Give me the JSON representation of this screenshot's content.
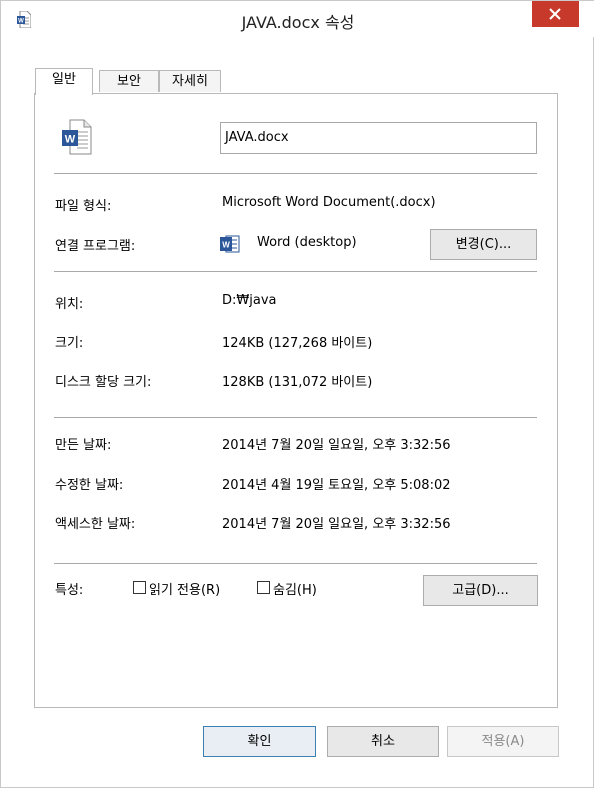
{
  "window": {
    "title": "JAVA.docx 속성"
  },
  "tabs": [
    {
      "label": "일반"
    },
    {
      "label": "보안"
    },
    {
      "label": "자세히"
    }
  ],
  "file": {
    "name": "JAVA.docx"
  },
  "general": {
    "file_type_label": "파일 형식:",
    "file_type_value": "Microsoft Word Document(.docx)",
    "opens_with_label": "연결 프로그램:",
    "opens_with_value": "Word (desktop)",
    "change_button": "변경(C)...",
    "location_label": "위치:",
    "location_value": "D:₩java",
    "size_label": "크기:",
    "size_value": "124KB (127,268 바이트)",
    "size_on_disk_label": "디스크 할당 크기:",
    "size_on_disk_value": "128KB (131,072 바이트)",
    "created_label": "만든 날짜:",
    "created_value": "2014년 7월 20일 일요일, 오후 3:32:56",
    "modified_label": "수정한 날짜:",
    "modified_value": "2014년 4월 19일 토요일, 오후 5:08:02",
    "accessed_label": "액세스한 날짜:",
    "accessed_value": "2014년 7월 20일 일요일, 오후 3:32:56",
    "attributes_label": "특성:",
    "readonly_label": "읽기 전용(R)",
    "readonly_checked": false,
    "hidden_label": "숨김(H)",
    "hidden_checked": false,
    "advanced_button": "고급(D)..."
  },
  "footer": {
    "ok": "확인",
    "cancel": "취소",
    "apply": "적용(A)"
  },
  "colors": {
    "close_button": "#c7392b",
    "word_blue": "#2b579a",
    "separator": "#a8a8a8"
  },
  "icons": {
    "title": "word-document-icon",
    "close": "close-icon",
    "file": "word-document-icon",
    "app": "word-app-icon"
  }
}
